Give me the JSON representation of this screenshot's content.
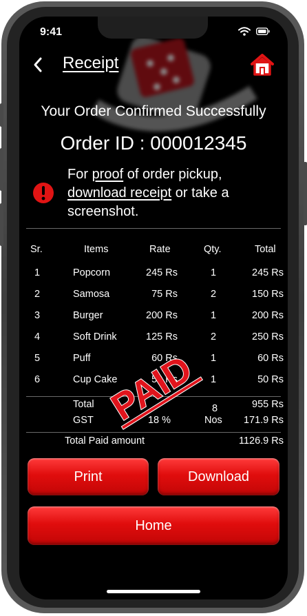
{
  "status_bar": {
    "time": "9:41"
  },
  "header": {
    "title": "Receipt",
    "back_icon": "chevron-left-icon",
    "home_icon": "house-icon"
  },
  "confirmation": "Your Order Confirmed Successfully",
  "order_id_label": "Order ID : 000012345",
  "notice": {
    "prefix": "For ",
    "proof": "proof",
    "middle": " of order pickup,",
    "download": "download receipt",
    "suffix": " or take a screenshot."
  },
  "table": {
    "headers": {
      "sr": "Sr.",
      "items": "Items",
      "rate": "Rate",
      "qty": "Qty.",
      "total": "Total"
    },
    "rows": [
      {
        "sr": "1",
        "item": "Popcorn",
        "rate": "245 Rs",
        "qty": "1",
        "total": "245 Rs"
      },
      {
        "sr": "2",
        "item": "Samosa",
        "rate": "75 Rs",
        "qty": "2",
        "total": "150 Rs"
      },
      {
        "sr": "3",
        "item": "Burger",
        "rate": "200 Rs",
        "qty": "1",
        "total": "200 Rs"
      },
      {
        "sr": "4",
        "item": "Soft Drink",
        "rate": "125 Rs",
        "qty": "2",
        "total": "250 Rs"
      },
      {
        "sr": "5",
        "item": "Puff",
        "rate": "60 Rs",
        "qty": "1",
        "total": "60 Rs"
      },
      {
        "sr": "6",
        "item": "Cup Cake",
        "rate": "50 Rs",
        "qty": "1",
        "total": "50 Rs"
      }
    ],
    "summary": {
      "total_label": "Total",
      "gst_label": "GST",
      "gst_rate": "18 %",
      "qty_count": "8",
      "qty_unit": "Nos",
      "total_value": "955 Rs",
      "gst_value": "171.9 Rs"
    },
    "paid_label": "Total Paid amount",
    "paid_value": "1126.9 Rs"
  },
  "stamp": "PAID",
  "buttons": {
    "print": "Print",
    "download": "Download",
    "home": "Home"
  },
  "colors": {
    "accent": "#e01414",
    "stamp": "#e0141c",
    "background": "#000000"
  }
}
